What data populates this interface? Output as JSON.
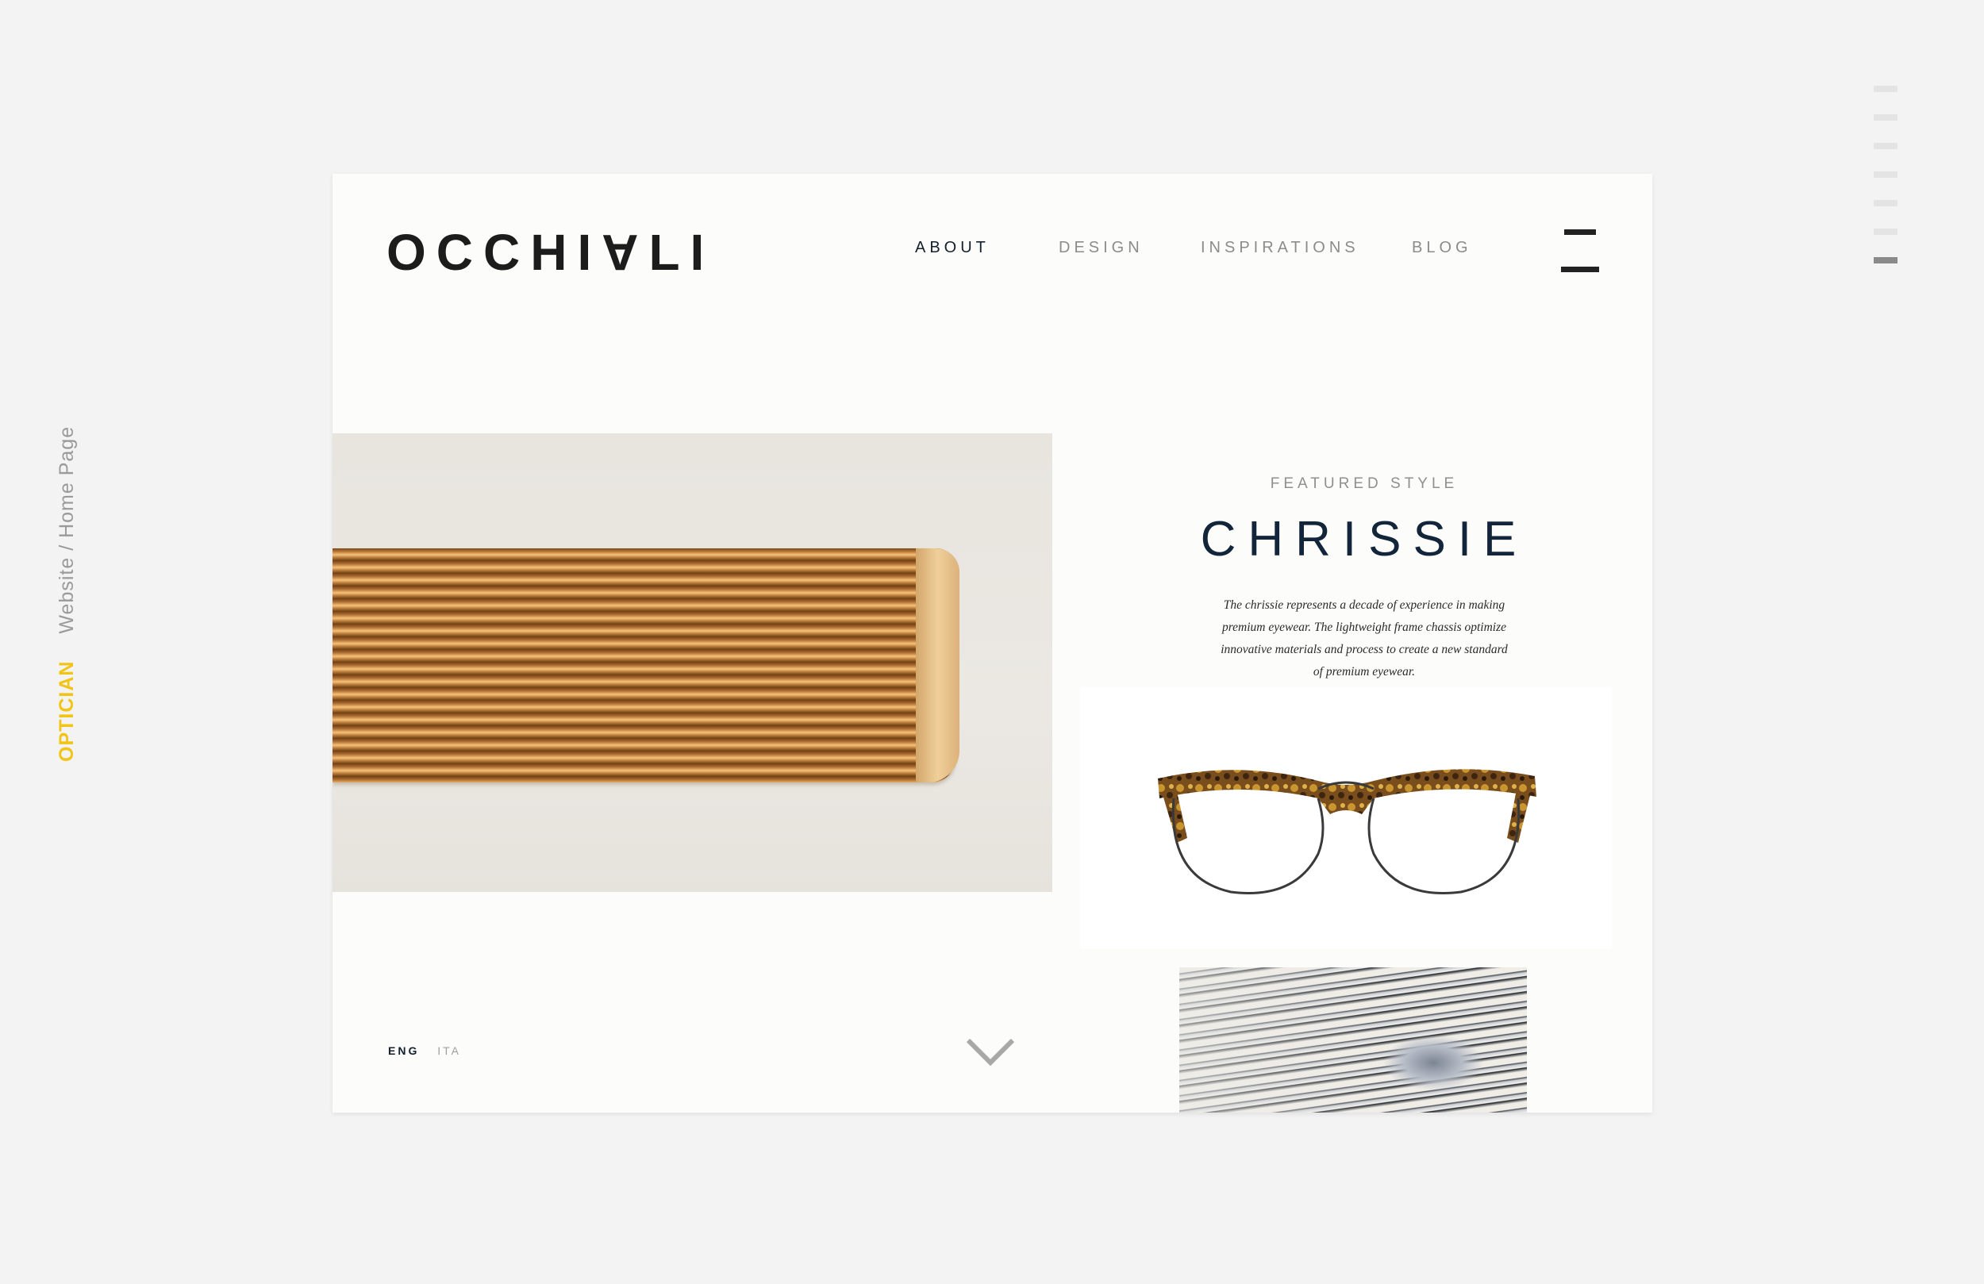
{
  "caption": {
    "tag": "OPTICIAN",
    "path": "Website / Home Page"
  },
  "pager": {
    "count": 7,
    "active_index": 6
  },
  "header": {
    "logo": {
      "before": "OCCHI",
      "flipped": "A",
      "after": "LI"
    },
    "nav": [
      {
        "label": "ABOUT",
        "active": true
      },
      {
        "label": "DESIGN",
        "active": false
      },
      {
        "label": "INSPIRATIONS",
        "active": false
      },
      {
        "label": "BLOG",
        "active": false
      }
    ],
    "menu_icon": "hamburger-icon"
  },
  "featured": {
    "label": "FEATURED STYLE",
    "title": "CHRISSIE",
    "description": "The chrissie represents a decade of experience in making premium eyewear. The lightweight frame chassis optimize innovative materials and process to create a new standard of premium eyewear."
  },
  "footer": {
    "languages": [
      {
        "label": "ENG",
        "active": true
      },
      {
        "label": "ITA",
        "active": false
      }
    ],
    "scroll_icon": "chevron-down-icon"
  },
  "colors": {
    "accent": "#f2c416",
    "nav_active": "#14202e",
    "nav_inactive": "#8c8c8c",
    "title": "#13253a",
    "background": "#f3f3f3",
    "card": "#fcfcfa"
  }
}
